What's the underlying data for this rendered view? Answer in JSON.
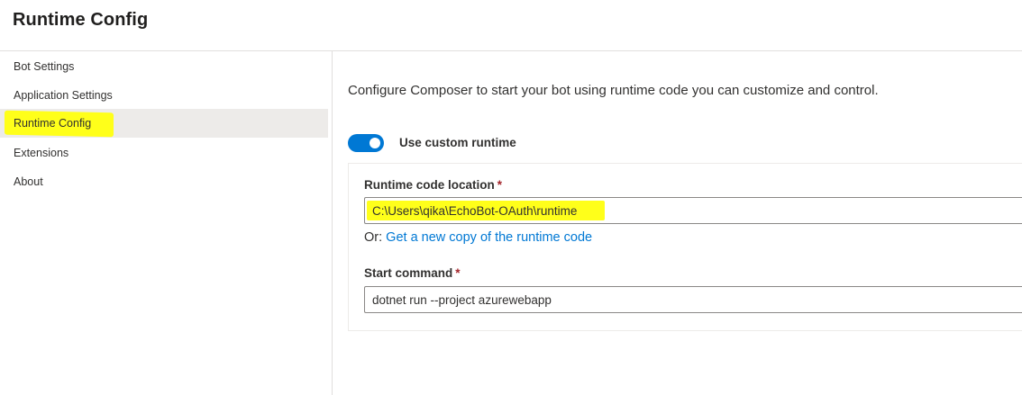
{
  "header": {
    "title": "Runtime Config"
  },
  "sidebar": {
    "items": [
      {
        "label": "Bot Settings",
        "selected": false
      },
      {
        "label": "Application Settings",
        "selected": false
      },
      {
        "label": "Runtime Config",
        "selected": true
      },
      {
        "label": "Extensions",
        "selected": false
      },
      {
        "label": "About",
        "selected": false
      }
    ]
  },
  "main": {
    "description": "Configure Composer to start your bot using runtime code you can customize and control.",
    "custom_runtime_toggle": {
      "label": "Use custom runtime",
      "checked": true
    },
    "runtime_location": {
      "label": "Runtime code location",
      "required_marker": "*",
      "value": "C:\\Users\\qika\\EchoBot-OAuth\\runtime"
    },
    "get_copy": {
      "prefix": "Or: ",
      "link_text": "Get a new copy of the runtime code"
    },
    "start_command": {
      "label": "Start command",
      "required_marker": "*",
      "value": "dotnet run --project azurewebapp"
    }
  },
  "colors": {
    "accent": "#0078d4",
    "highlight": "#ffff1a",
    "required": "#a4262c",
    "selected_bg": "#edebe9"
  }
}
